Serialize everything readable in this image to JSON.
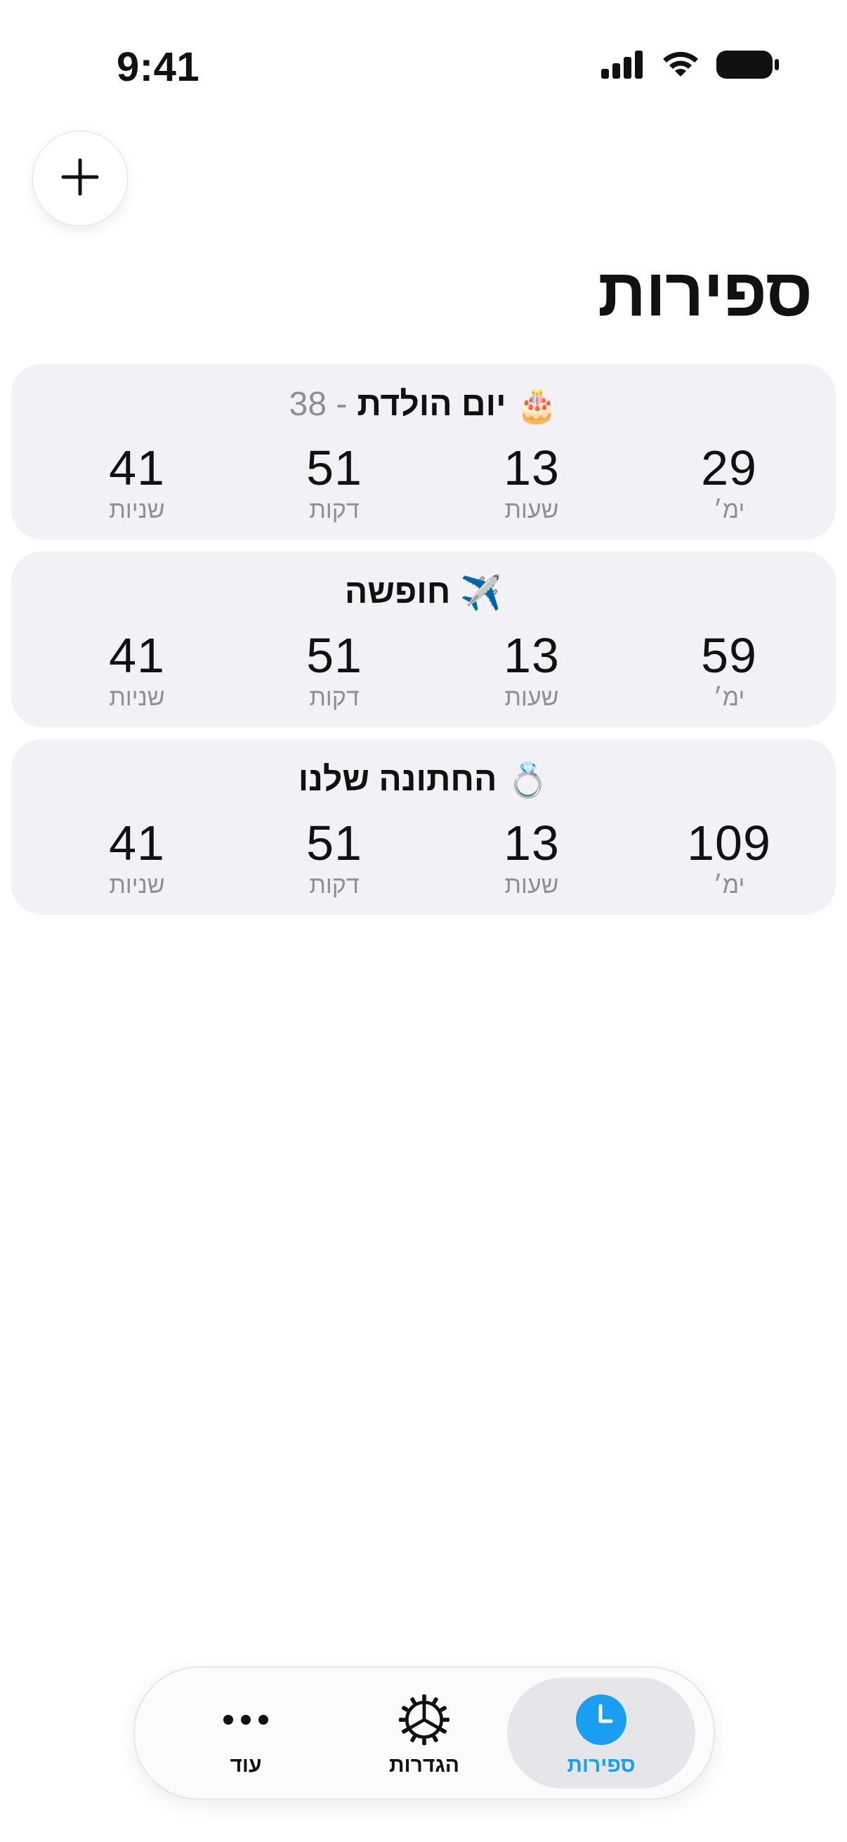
{
  "status_bar": {
    "time": "9:41"
  },
  "header": {
    "add_icon": "plus-icon",
    "title": "ספירות"
  },
  "unit_labels": {
    "years": "שניות",
    "minutes": "דקות",
    "hours": "שעות",
    "days": "ימ׳"
  },
  "cards": [
    {
      "emoji": "🎂",
      "title": "יום הולדת",
      "suffix": "- 38",
      "years": "41",
      "minutes": "51",
      "hours": "13",
      "days": "29"
    },
    {
      "emoji": "✈️",
      "title": "חופשה",
      "suffix": "",
      "years": "41",
      "minutes": "51",
      "hours": "13",
      "days": "59"
    },
    {
      "emoji": "💍",
      "title": "החתונה שלנו",
      "suffix": "",
      "years": "41",
      "minutes": "51",
      "hours": "13",
      "days": "109"
    }
  ],
  "tab_bar": {
    "more_label": "עוד",
    "settings_label": "הגדרות",
    "counters_label": "ספירות",
    "active_color": "#1a9ef0"
  }
}
